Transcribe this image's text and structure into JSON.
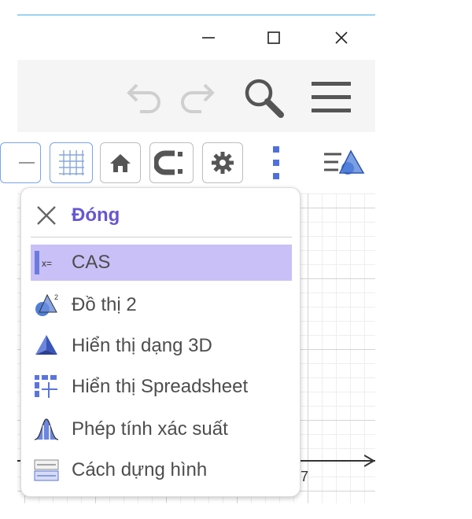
{
  "window": {
    "controls": {
      "minimize": "minimize-icon",
      "maximize": "maximize-icon",
      "close": "close-icon"
    }
  },
  "toolbar": {
    "icons": [
      "undo-icon",
      "redo-icon",
      "search-icon",
      "hamburger-menu-icon"
    ]
  },
  "graphics_style_bar": {
    "icons": [
      "axes-toggle-icon",
      "grid-toggle-icon",
      "home-icon",
      "magnet-icon",
      "gear-icon",
      "more-vertical-icon",
      "toggle-style-bar-icon"
    ]
  },
  "canvas": {
    "axis_label": "7"
  },
  "menu": {
    "close_label": "Đóng",
    "items": [
      {
        "label": "CAS",
        "icon": "cas-icon",
        "selected": true
      },
      {
        "label": "Đồ thị 2",
        "icon": "graphics-2-icon",
        "selected": false
      },
      {
        "label": "Hiển thị dạng 3D",
        "icon": "3d-graphics-icon",
        "selected": false
      },
      {
        "label": "Hiển thị Spreadsheet",
        "icon": "spreadsheet-icon",
        "selected": false
      },
      {
        "label": "Phép tính xác suất",
        "icon": "probability-icon",
        "selected": false
      },
      {
        "label": "Cách dựng hình",
        "icon": "construction-protocol-icon",
        "selected": false
      }
    ]
  },
  "colors": {
    "accent": "#6557d2",
    "selected_bg": "#c8c0f6",
    "icon_blue": "#4f8ae6",
    "toolbar_bg": "#f5f5f5"
  }
}
